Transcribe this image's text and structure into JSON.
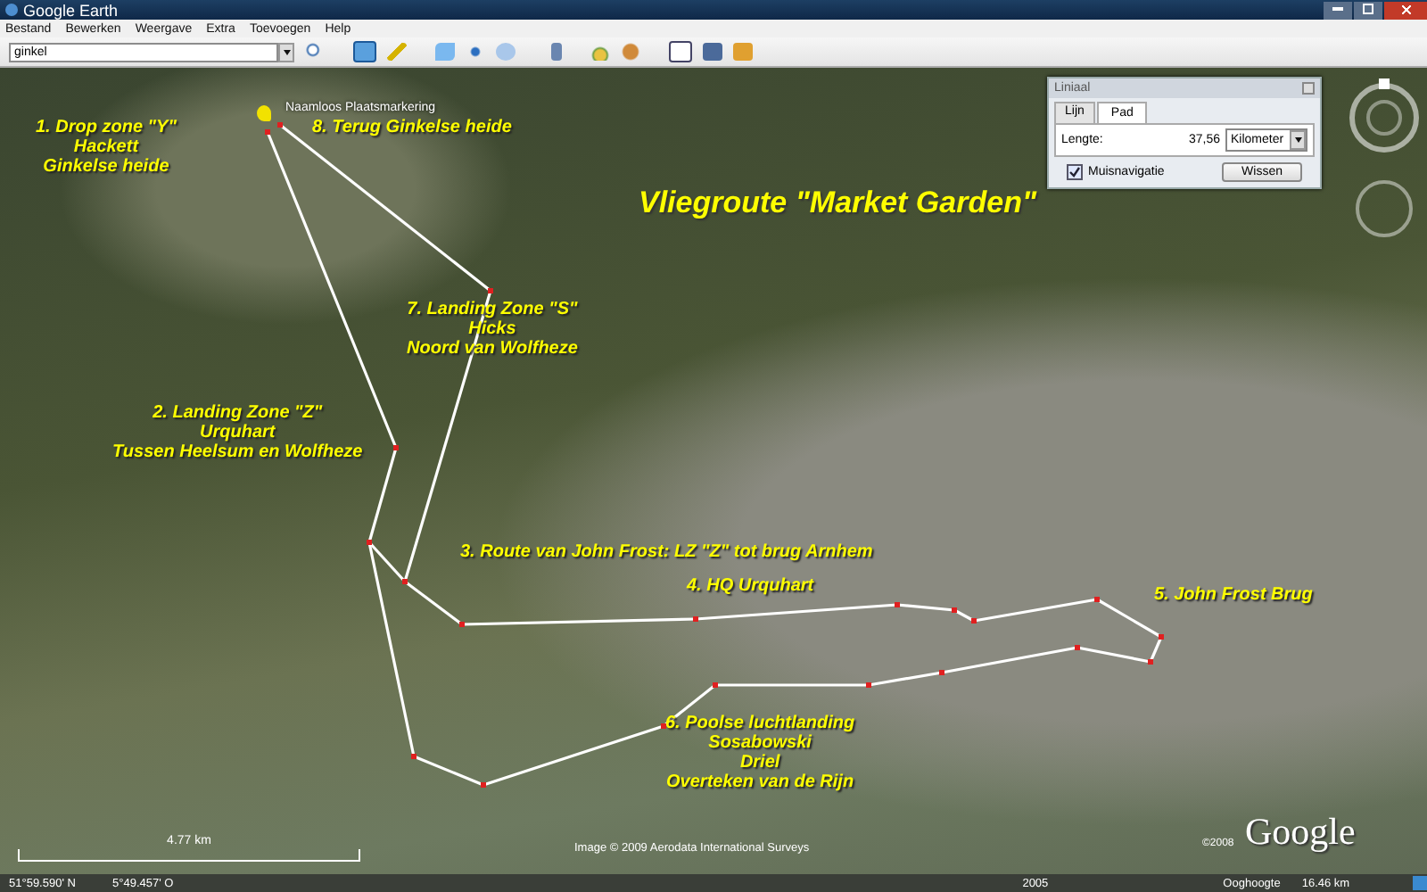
{
  "window": {
    "title": "Google Earth"
  },
  "menu": [
    "Bestand",
    "Bewerken",
    "Weergave",
    "Extra",
    "Toevoegen",
    "Help"
  ],
  "search": {
    "value": "ginkel"
  },
  "map": {
    "placemark": "Naamloos Plaatsmarkering",
    "title": "Vliegroute \"Market Garden\"",
    "labels": [
      {
        "lines": [
          "1. Drop zone \"Y\"",
          "Hackett",
          "Ginkelse heide"
        ]
      },
      {
        "lines": [
          "8. Terug Ginkelse heide"
        ]
      },
      {
        "lines": [
          "7. Landing Zone \"S\"",
          "Hicks",
          "Noord van Wolfheze"
        ]
      },
      {
        "lines": [
          "2. Landing Zone \"Z\"",
          "Urquhart",
          "Tussen Heelsum en Wolfheze"
        ]
      },
      {
        "lines": [
          "3. Route van John Frost: LZ \"Z\" tot brug Arnhem"
        ]
      },
      {
        "lines": [
          "4. HQ Urquhart"
        ]
      },
      {
        "lines": [
          "5. John Frost Brug"
        ]
      },
      {
        "lines": [
          "6. Poolse luchtlanding",
          "Sosabowski",
          "Driel",
          "Overteken van de Rijn"
        ]
      }
    ],
    "scale": "4.77 km",
    "attribution": "Image © 2009 Aerodata International Surveys",
    "copyright": "©2008",
    "logo": "Google"
  },
  "ruler": {
    "title": "Liniaal",
    "tabs": [
      {
        "label": "Lijn",
        "selected": false
      },
      {
        "label": "Pad",
        "selected": true
      }
    ],
    "length_label": "Lengte:",
    "length": "37,56",
    "unit": "Kilometer",
    "mouse_navigation": {
      "label": "Muisnavigatie",
      "checked": true
    },
    "button": "Wissen"
  },
  "status_bar": {
    "latitude": "51°59.590' N",
    "longitude": "5°49.457' O",
    "year": "2005",
    "altitude_label": "Ooghoogte",
    "altitude": "16.46 km"
  }
}
